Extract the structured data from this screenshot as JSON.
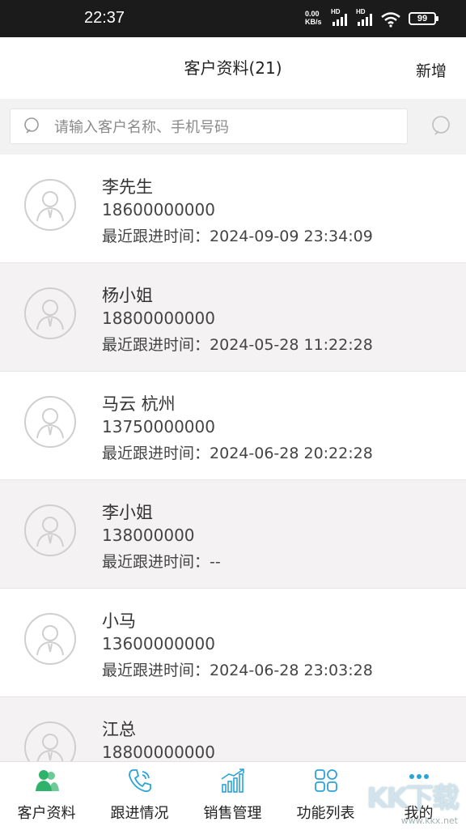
{
  "status_bar": {
    "time": "22:37",
    "net_speed_value": "0.00",
    "net_speed_unit": "KB/s",
    "signal_1_label": "HD",
    "signal_2_label": "HD",
    "battery": "99"
  },
  "header": {
    "title": "客户资料(21)",
    "add_label": "新增"
  },
  "search": {
    "placeholder": "请输入客户名称、手机号码",
    "value": ""
  },
  "follow_prefix": "最近跟进时间：",
  "customers": [
    {
      "name": "李先生",
      "phone": "18600000000",
      "follow_label": "最近跟进时间：",
      "follow_time": "2024-09-09 23:34:09"
    },
    {
      "name": "杨小姐",
      "phone": "18800000000",
      "follow_label": "最近跟进时间：",
      "follow_time": "2024-05-28 11:22:28"
    },
    {
      "name": "马云 杭州",
      "phone": "13750000000",
      "follow_label": "最近跟进时间：",
      "follow_time": "2024-06-28 20:22:28"
    },
    {
      "name": "李小姐",
      "phone": "138000000",
      "follow_label": "最近跟进时间：",
      "follow_time": "--"
    },
    {
      "name": "小马",
      "phone": "13600000000",
      "follow_label": "最近跟进时间：",
      "follow_time": "2024-06-28 23:03:28"
    },
    {
      "name": "江总",
      "phone": "18800000000",
      "follow_label": "",
      "follow_time": ""
    }
  ],
  "tabs": [
    {
      "label": "客户资料",
      "icon": "customer-icon",
      "active": true
    },
    {
      "label": "跟进情况",
      "icon": "phone-icon",
      "active": false
    },
    {
      "label": "销售管理",
      "icon": "chart-icon",
      "active": false
    },
    {
      "label": "功能列表",
      "icon": "grid-icon",
      "active": false
    },
    {
      "label": "我的",
      "icon": "more-dots-icon",
      "active": false
    }
  ],
  "colors": {
    "accent": "#2fb36b",
    "icon_blue": "#2aa3d9",
    "alt_row": "#f4f2f2"
  },
  "watermark": {
    "brand": "KK下载",
    "url": "www.kkx.net"
  }
}
